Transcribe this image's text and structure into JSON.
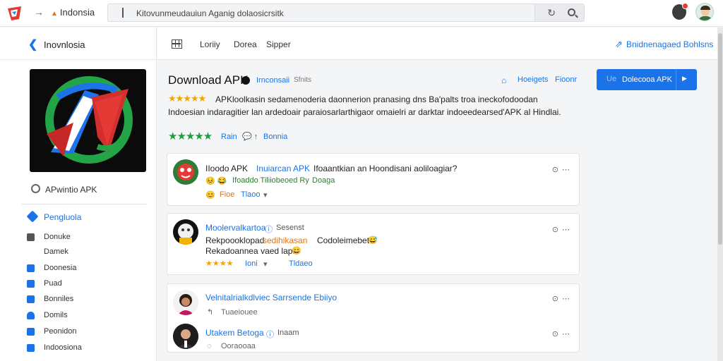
{
  "topbar": {
    "site": "Indonsia",
    "url": "Kitovunmeudauiun Aganig dolaosicrsitk"
  },
  "sidebar": {
    "title": "Inovnlosia",
    "radio_label": "APwintio APK",
    "section": "Pengluola",
    "items": [
      {
        "label": "Donuke",
        "color": "#555555"
      },
      {
        "label": "Damek",
        "color": "#ffffff"
      },
      {
        "label": "Doonesia",
        "color": "#1a73e8"
      },
      {
        "label": "Puad",
        "color": "#1a73e8"
      },
      {
        "label": "Bonniles",
        "color": "#1a73e8"
      },
      {
        "label": "Domils",
        "color": "#1a73e8"
      },
      {
        "label": "Peonidon",
        "color": "#1a73e8"
      },
      {
        "label": "Indoosiona",
        "color": "#1a73e8"
      }
    ]
  },
  "main": {
    "tabs": [
      "Loriiy",
      "Dorea",
      "Sipper"
    ],
    "header_link": "Bnidnenagaed Bohlsns"
  },
  "app": {
    "title": "Download APK",
    "subtitle": "Irnconsaii",
    "subtitle2": "Sfnits",
    "link1": "Hoeigets",
    "link2": "Fioonr",
    "download_button": "Dolecooa APK",
    "download_pre": "Ue",
    "desc_stars": "★★★★★",
    "desc_line1": "APKloolkasin sedamenoderia daonnerion pranasing dns Ba'palts troa ineckofodoodan",
    "desc_line2": "Indoesian indaragitier lan ardedoair paraiosarlarthigaor omaielri ar darktar indoeedearsed'APK al Hindlai.",
    "rating_stars": "★★★★★",
    "rating_label": "Rain",
    "rating_count": "Bonnia"
  },
  "reviews": [
    {
      "title": "IIoodo APK",
      "title_blue": "Inuiarcan APK",
      "title_rest": "Ifoaantkian an Hoondisani aoliloagiar?",
      "sub_emojis": "😣 😂",
      "sub_text": "Ifoaddo Tiliiobeoed Ry",
      "sub_tag": "Doaga",
      "meta1": "Fioe",
      "meta2": "Tlaoo"
    },
    {
      "title": "Moolervalkartoa",
      "title_tag": "Sesenst",
      "line1_a": "Rekpoooklopad",
      "line1_b": "sedihikasan",
      "line1_c": "Codoleimebet",
      "line2": "Rekadoannea vaed lapa",
      "stars": "★★★★",
      "meta1": "Ioni",
      "meta2": "Tldaeo"
    },
    {
      "title": "Velnitalrialkdlviec Sarrsende Ebiiyo",
      "meta": "Tuaeiouee",
      "title2": "Utakem Betoga",
      "tag2": "Inaam",
      "meta2": "Ooraooaa"
    }
  ]
}
